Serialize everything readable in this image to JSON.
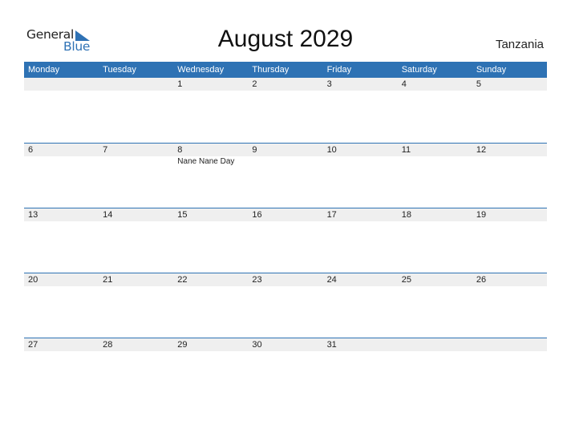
{
  "logo": {
    "word1": "General",
    "word2": "Blue"
  },
  "title": "August 2029",
  "country": "Tanzania",
  "colors": {
    "accent": "#2e72b4",
    "band": "#efefef"
  },
  "weekdays": [
    "Monday",
    "Tuesday",
    "Wednesday",
    "Thursday",
    "Friday",
    "Saturday",
    "Sunday"
  ],
  "weeks": [
    {
      "days": [
        "",
        "",
        "1",
        "2",
        "3",
        "4",
        "5"
      ],
      "events": [
        "",
        "",
        "",
        "",
        "",
        "",
        ""
      ]
    },
    {
      "days": [
        "6",
        "7",
        "8",
        "9",
        "10",
        "11",
        "12"
      ],
      "events": [
        "",
        "",
        "Nane Nane Day",
        "",
        "",
        "",
        ""
      ]
    },
    {
      "days": [
        "13",
        "14",
        "15",
        "16",
        "17",
        "18",
        "19"
      ],
      "events": [
        "",
        "",
        "",
        "",
        "",
        "",
        ""
      ]
    },
    {
      "days": [
        "20",
        "21",
        "22",
        "23",
        "24",
        "25",
        "26"
      ],
      "events": [
        "",
        "",
        "",
        "",
        "",
        "",
        ""
      ]
    },
    {
      "days": [
        "27",
        "28",
        "29",
        "30",
        "31",
        "",
        ""
      ],
      "events": [
        "",
        "",
        "",
        "",
        "",
        "",
        ""
      ]
    }
  ]
}
